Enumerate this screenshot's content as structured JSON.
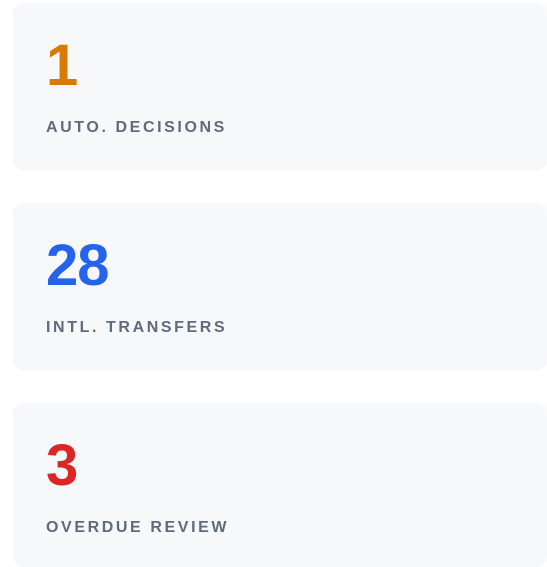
{
  "stats": [
    {
      "value": "1",
      "label": "AUTO. DECISIONS",
      "color": "#d97a06"
    },
    {
      "value": "28",
      "label": "INTL. TRANSFERS",
      "color": "#2563eb"
    },
    {
      "value": "3",
      "label": "OVERDUE REVIEW",
      "color": "#dc2626"
    }
  ]
}
